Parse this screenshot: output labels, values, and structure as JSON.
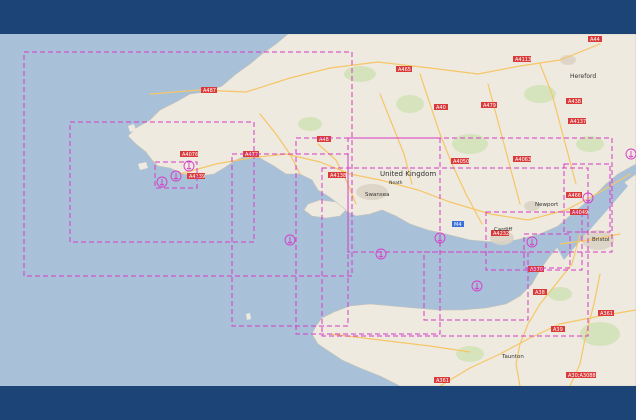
{
  "colors": {
    "frame": "#1d4476",
    "sea": "#a8c0d8",
    "land": "#eeeadf",
    "road_primary": "#f6c667",
    "road_label_bg": "#d93a3a",
    "chart_outline": "#d63bc6"
  },
  "map": {
    "country_label": "United Kingdom",
    "towns": {
      "hereford": "Hereford",
      "swansea": "Swansea",
      "neath": "Neath",
      "newport": "Newport",
      "cardiff": "Cardiff",
      "bristol": "Bristol",
      "taunton": "Taunton"
    },
    "roads": {
      "a44": "A44",
      "a487": "A487",
      "a4113": "A4113",
      "a479": "A479",
      "a438": "A438",
      "a40_north": "A40",
      "a4076": "A4076",
      "a4139": "A4139",
      "a477": "A477",
      "a48": "A48",
      "a4138": "A4138",
      "a4050": "A4050",
      "a4063": "A4063",
      "a4137": "A4137",
      "a466": "A466",
      "a4049": "A4049",
      "a465": "A465",
      "m4": "M4",
      "a4232": "A4232",
      "a370": "A370",
      "a38": "A38",
      "a39": "A39",
      "a361": "A361",
      "a361_south": "A361",
      "a30_a3088": "A30;A3088"
    },
    "chart_panels_count": 11,
    "anchor_markers_count": 10
  }
}
